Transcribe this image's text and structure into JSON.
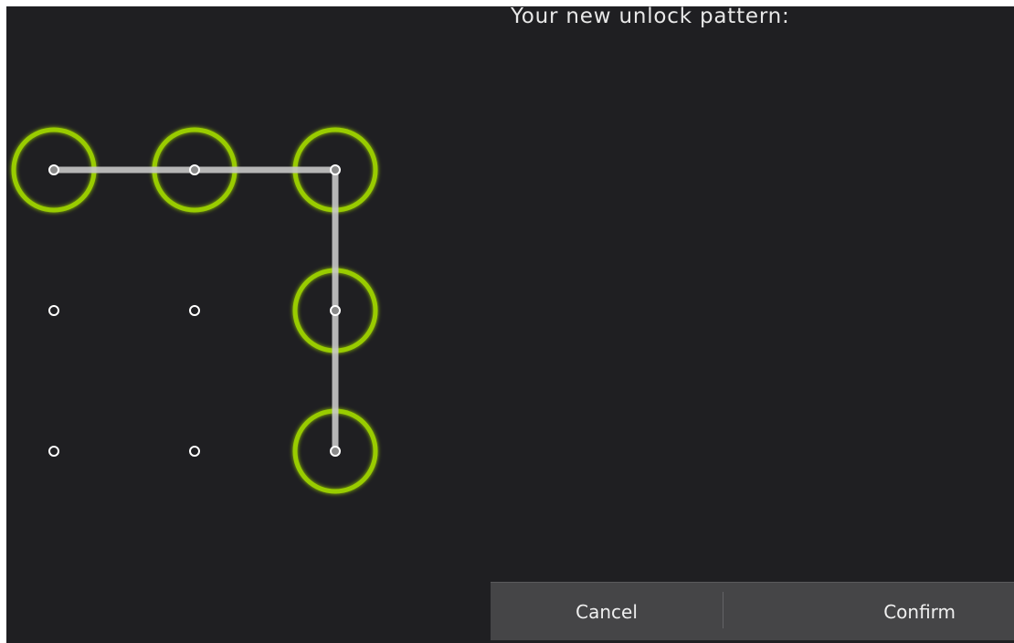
{
  "title": "Your new unlock pattern:",
  "buttons": {
    "cancel_label": "Cancel",
    "confirm_label": "Confirm"
  },
  "pattern": {
    "selected_cells": [
      0,
      1,
      2,
      5,
      8
    ],
    "cell_count": 9
  },
  "colors": {
    "background": "#1f1f22",
    "ring": "#99cc00",
    "line": "#c7c7c7",
    "dot": "#ffffff",
    "button_bar": "#454547"
  }
}
